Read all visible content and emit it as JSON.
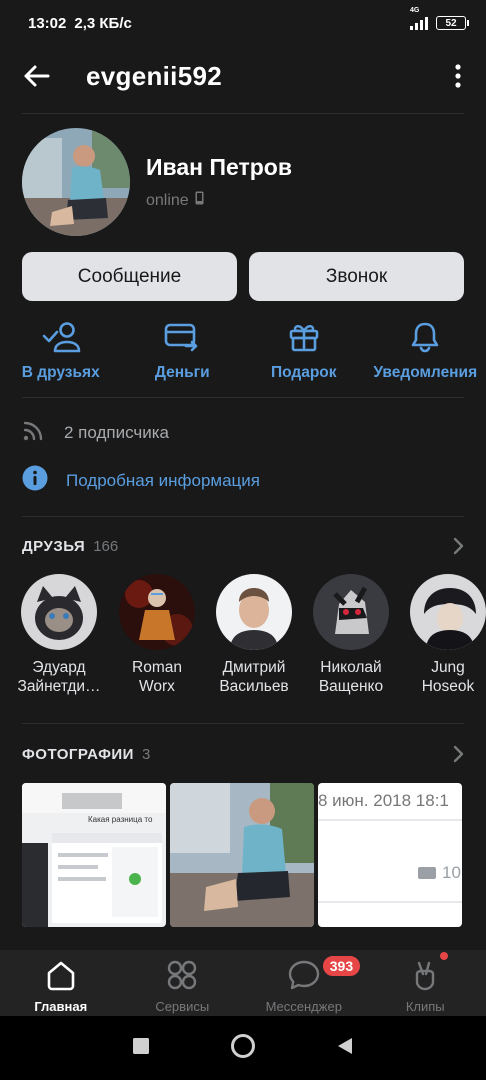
{
  "status_bar": {
    "time": "13:02",
    "net_speed": "2,3 КБ/с",
    "network": "4G",
    "battery": "52"
  },
  "header": {
    "username": "evgenii592"
  },
  "profile": {
    "name": "Иван Петров",
    "status": "online"
  },
  "buttons": {
    "message": "Сообщение",
    "call": "Звонок"
  },
  "actions": [
    {
      "label": "В друзьях",
      "icon": "user-check-icon"
    },
    {
      "label": "Деньги",
      "icon": "card-transfer-icon"
    },
    {
      "label": "Подарок",
      "icon": "gift-icon"
    },
    {
      "label": "Уведомления",
      "icon": "bell-icon"
    }
  ],
  "subscribers": {
    "label": "2 подписчика"
  },
  "details": {
    "label": "Подробная информация"
  },
  "friends": {
    "title": "ДРУЗЬЯ",
    "count": "166",
    "items": [
      {
        "name": "Эдуард",
        "name2": "Зайнетди…"
      },
      {
        "name": "Roman",
        "name2": "Worx"
      },
      {
        "name": "Дмитрий",
        "name2": "Васильев"
      },
      {
        "name": "Николай",
        "name2": "Ващенко"
      },
      {
        "name": "Jung",
        "name2": "Hoseok"
      }
    ]
  },
  "photos": {
    "title": "ФОТОГРАФИИ",
    "count": "3",
    "p1_caption": "Какая разница то",
    "p3_text": "8 июн. 2018 18:1",
    "p3_num": "10"
  },
  "tabbar": {
    "items": [
      {
        "label": "Главная"
      },
      {
        "label": "Сервисы"
      },
      {
        "label": "Мессенджер",
        "badge": "393"
      },
      {
        "label": "Клипы"
      }
    ]
  },
  "colors": {
    "accent": "#5a9ee0",
    "background": "#19191a",
    "badge": "#e64646"
  }
}
